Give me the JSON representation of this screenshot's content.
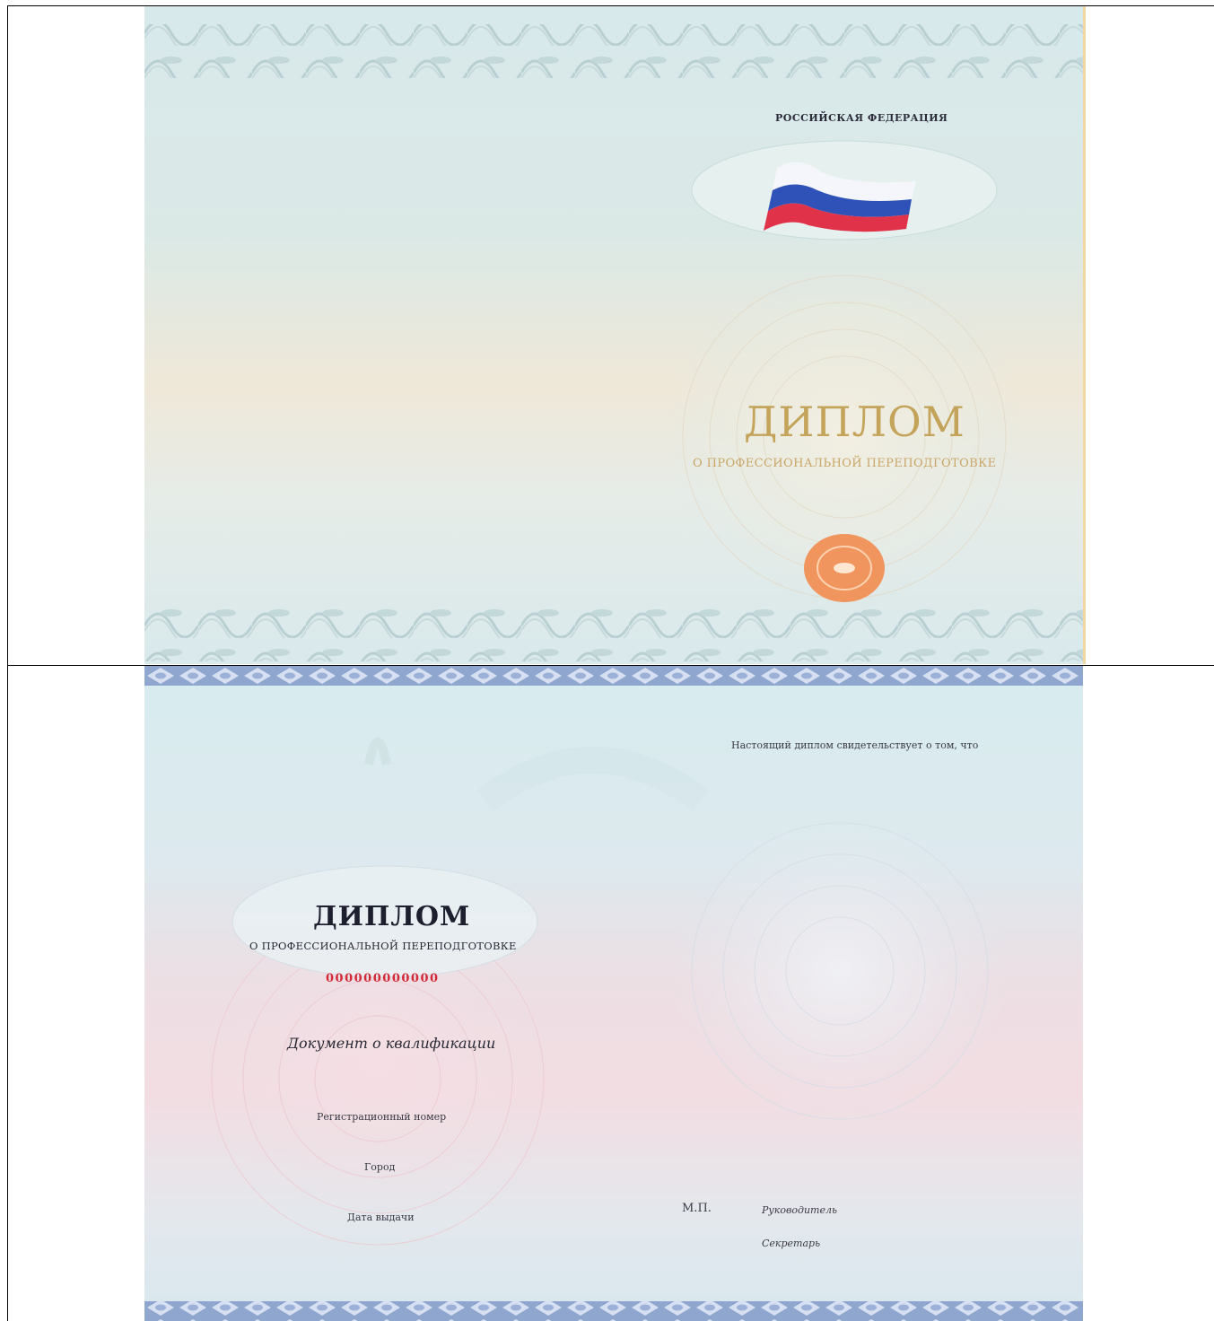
{
  "cover": {
    "country": "РОССИЙСКАЯ ФЕДЕРАЦИЯ",
    "title": "ДИПЛОМ",
    "subtitle": "О ПРОФЕССИОНАЛЬНОЙ ПЕРЕПОДГОТОВКЕ",
    "flag_colors": [
      "#ffffff",
      "#2f52b8",
      "#e0334a"
    ],
    "title_color": "#c4a35a",
    "seal_color": "#f1955f"
  },
  "inner": {
    "title": "ДИПЛОМ",
    "subtitle": "О ПРОФЕССИОНАЛЬНОЙ ПЕРЕПОДГОТОВКЕ",
    "number": "000000000000",
    "number_color": "#d42a38",
    "document_type": "Документ о квалификации",
    "registration_label": "Регистрационный номер",
    "city_label": "Город",
    "issue_date_label": "Дата выдачи",
    "certifies_text": "Настоящий диплом свидетельствует о том, что",
    "seal_place": "М.П.",
    "head_label": "Руководитель",
    "secretary_label": "Секретарь"
  }
}
